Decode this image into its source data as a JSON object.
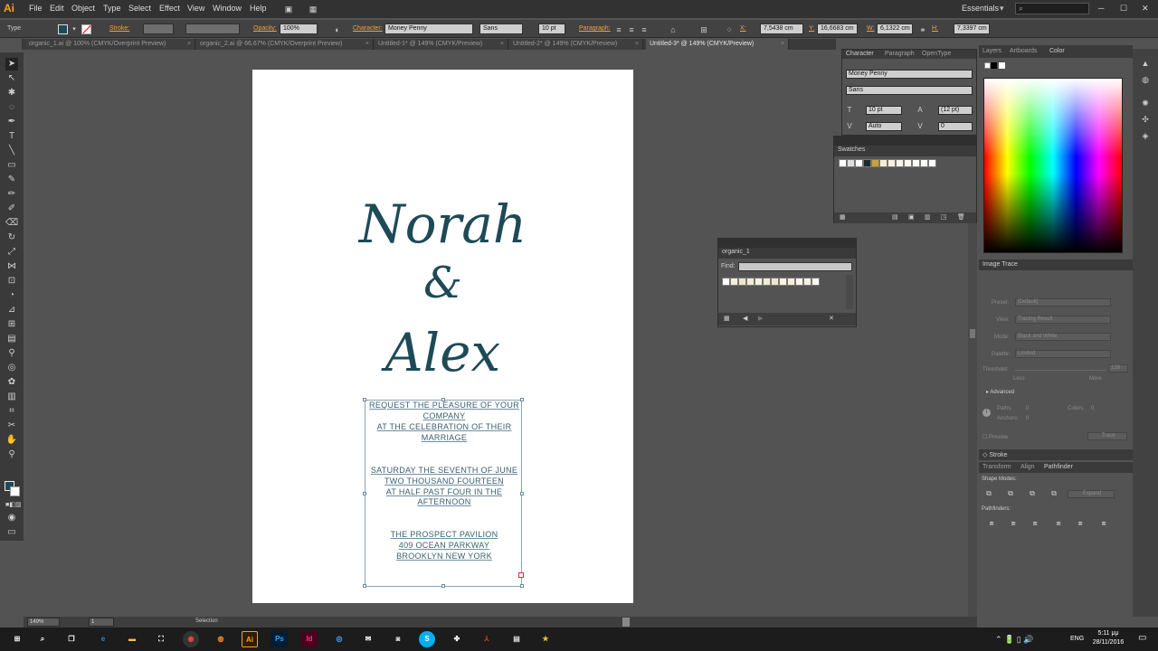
{
  "menu": {
    "logo": "Ai",
    "items": [
      "File",
      "Edit",
      "Object",
      "Type",
      "Select",
      "Effect",
      "View",
      "Window",
      "Help"
    ],
    "workspace": "Essentials"
  },
  "control_bar": {
    "tool_name": "Type",
    "stroke_label": "Stroke:",
    "opacity_label": "Opacity:",
    "opacity_value": "100%",
    "character_label": "Character:",
    "font_family": "Money Penny",
    "font_style": "Sans",
    "font_size": "10 pt",
    "paragraph_label": "Paragraph:",
    "x_label": "X:",
    "x_value": "7,5438 cm",
    "y_label": "Y:",
    "y_value": "16,6683 cm",
    "w_label": "W:",
    "w_value": "6,1322 cm",
    "h_label": "H:",
    "h_value": "7,3397 cm"
  },
  "doc_tabs": [
    {
      "label": "organic_1.ai @ 100% (CMYK/Overprint Preview)"
    },
    {
      "label": "organic_2.ai @ 66,67% (CMYK/Overprint Preview)"
    },
    {
      "label": "Untitled-1* @ 149% (CMYK/Preview)"
    },
    {
      "label": "Untitled-2* @ 149% (CMYK/Preview)"
    },
    {
      "label": "Untitled-3* @ 149% (CMYK/Preview)"
    }
  ],
  "artboard": {
    "name_line1": "Norah",
    "ampersand": "&",
    "name_line2": "Alex",
    "body": [
      "REQUEST THE PLEASURE OF YOUR",
      "COMPANY",
      "AT THE CELEBRATION OF THEIR",
      "MARRIAGE",
      "SATURDAY THE SEVENTH OF JUNE",
      "TWO THOUSAND FOURTEEN",
      "AT HALF PAST FOUR IN THE",
      "AFTERNOON",
      "THE PROSPECT PAVILION",
      "409 OCEAN PARKWAY",
      "BROOKLYN NEW YORK"
    ],
    "text_color": "#1e4a57"
  },
  "character_panel": {
    "tabs": [
      "Character",
      "Paragraph",
      "OpenType"
    ],
    "font_family": "Money Penny",
    "font_style": "Sans",
    "size": "10 pt",
    "leading": "(12 pt)",
    "kerning": "Auto",
    "tracking": "0"
  },
  "swatches_panel": {
    "title": "Swatches"
  },
  "organic_panel": {
    "title": "organic_1",
    "find_label": "Find:"
  },
  "right_panels": {
    "top_tabs": [
      "Layers",
      "Artboards",
      "Color"
    ],
    "image_trace_title": "Image Trace",
    "preset_label": "Preset:",
    "preset_value": "[Default]",
    "view_label": "View:",
    "view_value": "Tracing Result",
    "mode_label": "Mode:",
    "mode_value": "Black and White",
    "palette_label": "Palette:",
    "palette_value": "Limited",
    "threshold_label": "Threshold:",
    "threshold_value": "128",
    "less_label": "Less",
    "more_label": "More",
    "advanced_label": "Advanced",
    "paths_label": "Paths:",
    "paths_value": "0",
    "colors_label": "Colors:",
    "colors_value": "0",
    "anchors_label": "Anchors:",
    "anchors_value": "0",
    "preview_label": "Preview",
    "trace_button": "Trace",
    "stroke_title": "Stroke",
    "lower_tabs": [
      "Transform",
      "Align",
      "Pathfinder"
    ],
    "shape_modes_label": "Shape Modes:",
    "expand_button": "Expand",
    "pathfinders_label": "Pathfinders:"
  },
  "status": {
    "zoom": "149%",
    "artboard_num": "1",
    "tool": "Selection"
  },
  "taskbar": {
    "lang": "ENG",
    "time": "5:11 μμ",
    "date": "28/11/2016"
  }
}
